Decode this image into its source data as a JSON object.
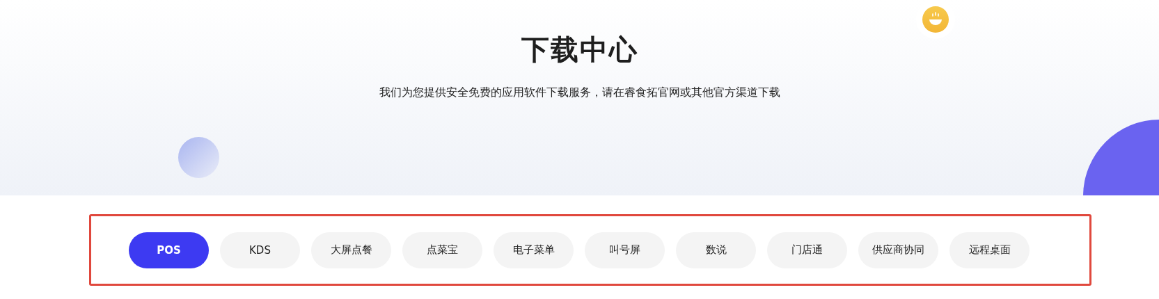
{
  "header": {
    "title": "下载中心",
    "subtitle": "我们为您提供安全免费的应用软件下载服务，请在睿食拓官网或其他官方渠道下载"
  },
  "tabs": [
    {
      "label": "POS",
      "selected": true
    },
    {
      "label": "KDS",
      "selected": false
    },
    {
      "label": "大屏点餐",
      "selected": false
    },
    {
      "label": "点菜宝",
      "selected": false
    },
    {
      "label": "电子菜单",
      "selected": false
    },
    {
      "label": "叫号屏",
      "selected": false
    },
    {
      "label": "数说",
      "selected": false
    },
    {
      "label": "门店通",
      "selected": false
    },
    {
      "label": "供应商协同",
      "selected": false
    },
    {
      "label": "远程桌面",
      "selected": false
    }
  ]
}
